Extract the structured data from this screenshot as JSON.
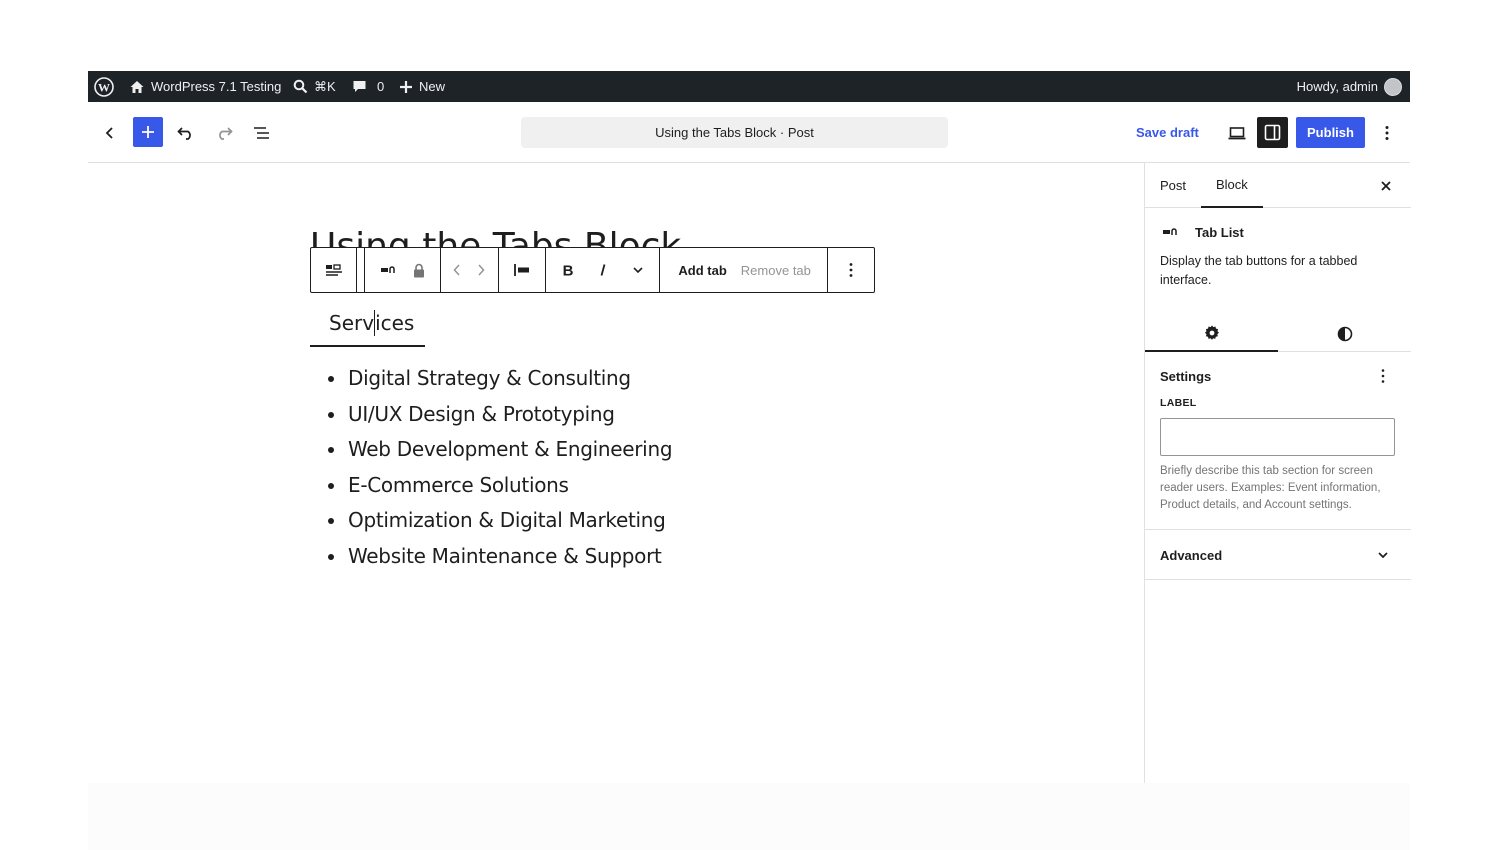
{
  "admin_bar": {
    "site_name": "WordPress 7.1 Testing",
    "search_shortcut": "⌘K",
    "comments_count": "0",
    "new_label": "New",
    "greeting": "Howdy, admin"
  },
  "header": {
    "document_title": "Using the Tabs Block · Post",
    "save_draft_label": "Save draft",
    "publish_label": "Publish"
  },
  "canvas": {
    "post_title": "Using the Tabs Block",
    "toolbar": {
      "add_tab_label": "Add tab",
      "remove_tab_label": "Remove tab"
    },
    "tab_label_before_caret": "Serv",
    "tab_label_after_caret": "ices",
    "services": [
      "Digital Strategy & Consulting",
      "UI/UX Design & Prototyping",
      "Web Development & Engineering",
      "E-Commerce Solutions",
      "Optimization & Digital Marketing",
      "Website Maintenance & Support"
    ]
  },
  "sidebar": {
    "tabs": [
      "Post",
      "Block"
    ],
    "active_tab": "Block",
    "block_name": "Tab List",
    "block_description": "Display the tab buttons for a tabbed interface.",
    "settings_title": "Settings",
    "label_field_label": "LABEL",
    "label_field_value": "",
    "label_help": "Briefly describe this tab section for screen reader users. Examples: Event information, Product details, and Account settings.",
    "advanced_title": "Advanced"
  },
  "colors": {
    "accent": "#3858e9",
    "admin_bar_bg": "#1d2327",
    "text": "#1e1e1e",
    "muted": "#757575",
    "border": "#e0e0e0"
  },
  "icons": [
    "wordpress-logo-icon",
    "home-icon",
    "search-icon",
    "comment-icon",
    "plus-icon",
    "back-chevron-icon",
    "undo-icon",
    "redo-icon",
    "document-overview-icon",
    "desktop-preview-icon",
    "settings-panel-icon",
    "more-vertical-icon",
    "tab-list-icon",
    "lock-icon",
    "chevron-left-icon",
    "chevron-right-icon",
    "justify-left-icon",
    "bold-icon",
    "italic-icon",
    "chevron-down-icon",
    "close-icon",
    "gear-icon",
    "contrast-icon"
  ]
}
